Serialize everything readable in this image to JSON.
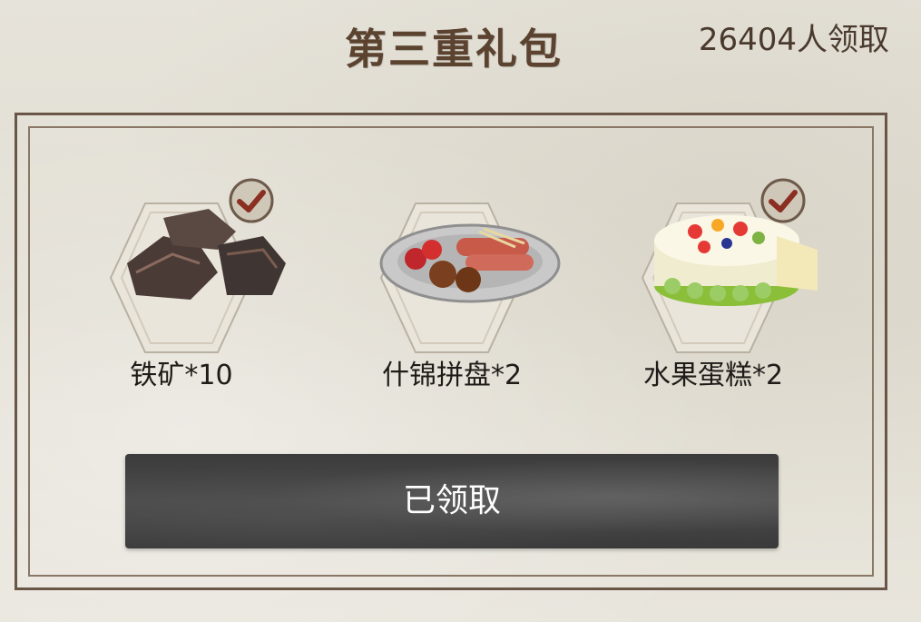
{
  "header": {
    "title": "第三重礼包",
    "claim_count": "26404人领取"
  },
  "rewards": [
    {
      "label": "铁矿*10",
      "icon": "iron-ore-icon",
      "claimed": true
    },
    {
      "label": "什锦拼盘*2",
      "icon": "food-platter-icon",
      "claimed": false
    },
    {
      "label": "水果蛋糕*2",
      "icon": "fruit-cake-icon",
      "claimed": true
    }
  ],
  "action": {
    "label": "已领取"
  },
  "colors": {
    "background": "#e4e1d8",
    "frame": "#6a5646",
    "check_badge": "#8a2f22",
    "button": "#3f3f3f"
  }
}
